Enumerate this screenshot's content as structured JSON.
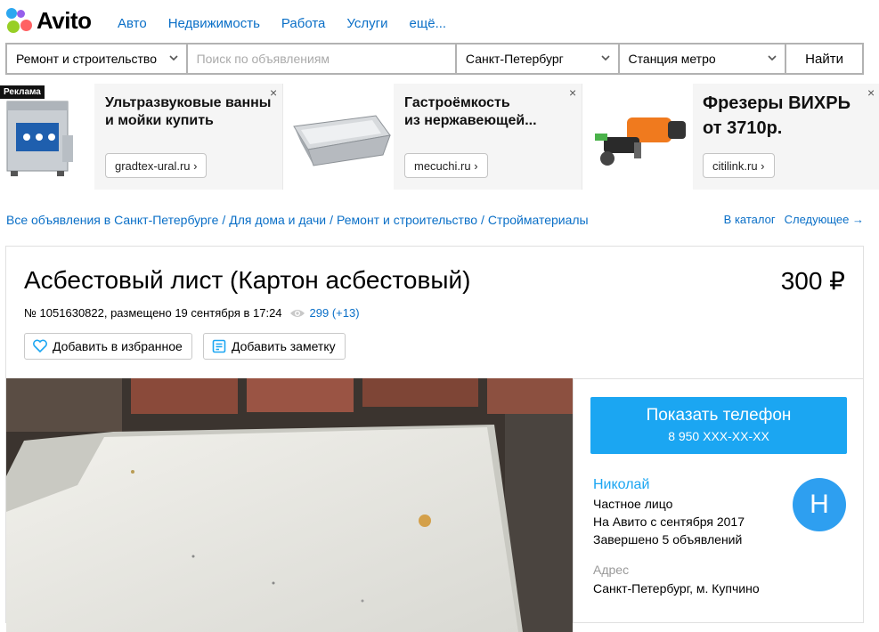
{
  "header": {
    "logo_text": "Avito",
    "nav": [
      "Авто",
      "Недвижимость",
      "Работа",
      "Услуги",
      "ещё..."
    ]
  },
  "search": {
    "category": "Ремонт и строительство",
    "query_placeholder": "Поиск по объявлениям",
    "city": "Санкт-Петербург",
    "metro": "Станция метро",
    "submit": "Найти"
  },
  "ads": {
    "badge": "Реклама",
    "items": [
      {
        "title_line1": "Ультразвуковые ванны",
        "title_line2": "и мойки купить",
        "site": "gradtex-ural.ru ›"
      },
      {
        "title_line1": "Гастроёмкость",
        "title_line2": "из нержавеющей...",
        "site": "mecuchi.ru ›"
      },
      {
        "title_line1": "Фрезеры ВИХРЬ",
        "title_line2": "от 3710р.",
        "site": "citilink.ru ›"
      }
    ],
    "close": "×"
  },
  "breadcrumbs": {
    "items": [
      "Все объявления в Санкт-Петербурге",
      "Для дома и дачи",
      "Ремонт и строительство",
      "Стройматериалы"
    ],
    "separator": "/",
    "catalog": "В каталог",
    "next": "Следующее →"
  },
  "listing": {
    "title": "Асбестовый лист (Картон асбестовый)",
    "price": "300 ₽",
    "meta": "№ 1051630822, размещено 19 сентября в 17:24",
    "views": "299 (+13)",
    "favorite_label": "Добавить в избранное",
    "note_label": "Добавить заметку"
  },
  "contact": {
    "show_phone": "Показать телефон",
    "phone_masked": "8 950 XXX-XX-XX",
    "seller_name": "Николай",
    "seller_type": "Частное лицо",
    "since": "На Авито с сентября 2017",
    "completed": "Завершено 5 объявлений",
    "avatar_letter": "Н",
    "address_label": "Адрес",
    "address": "Санкт-Петербург, м. Купчино"
  },
  "colors": {
    "link": "#0a6fc7",
    "accent": "#1ba6f2",
    "avatar": "#2e9ff0"
  }
}
